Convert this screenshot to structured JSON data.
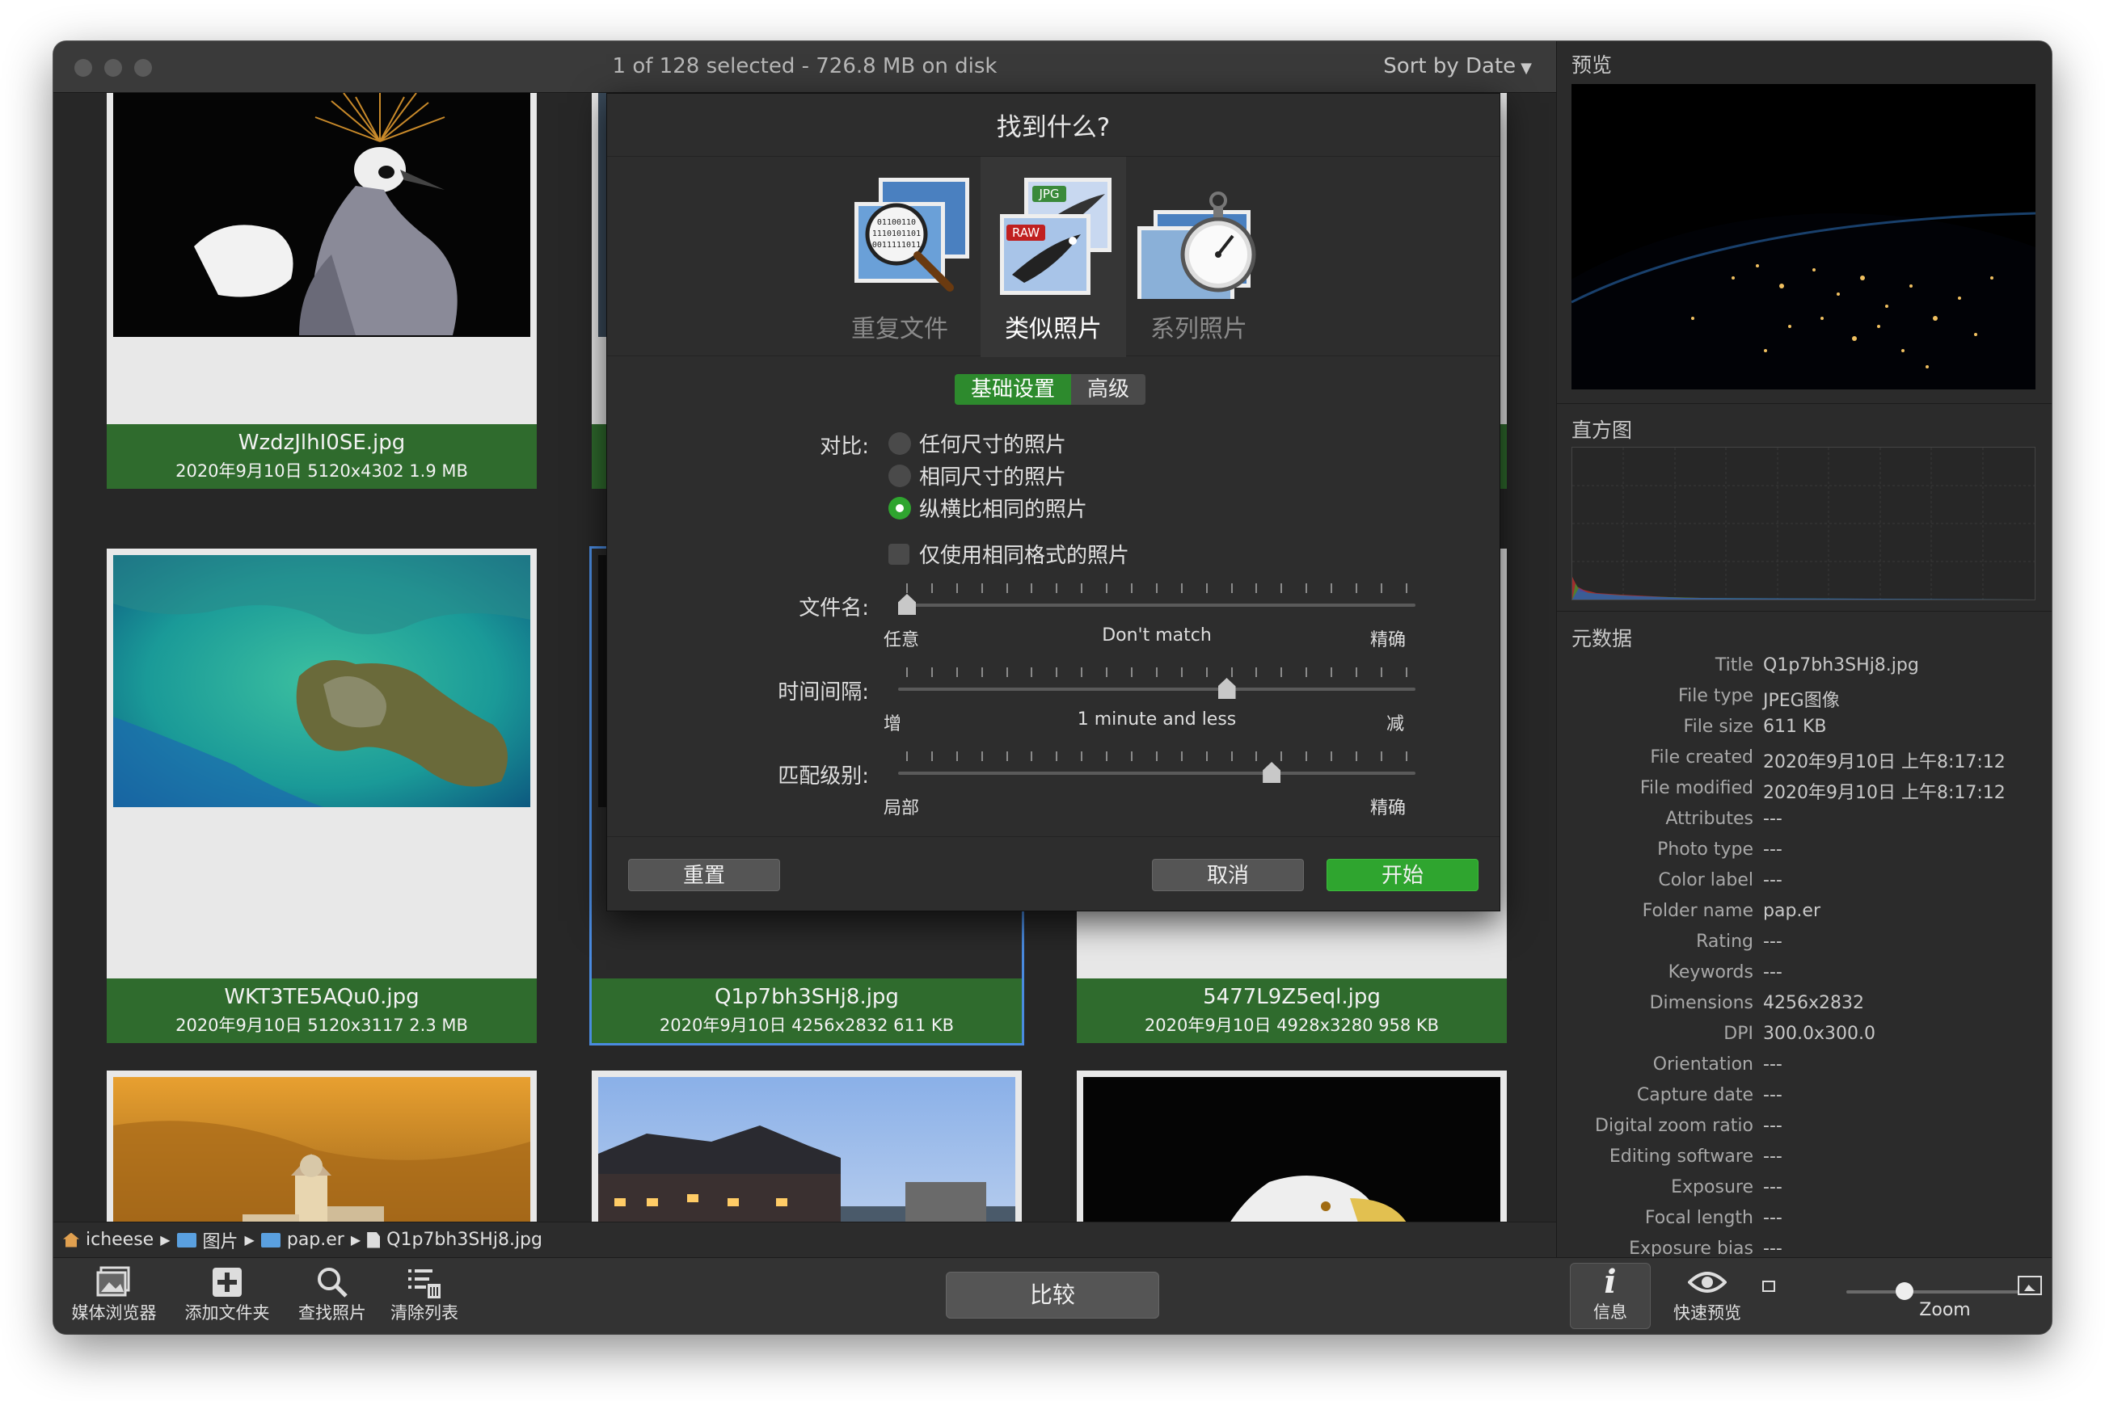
{
  "titlebar": {
    "title": "1 of 128 selected - 726.8 MB on disk",
    "sort_label": "Sort by Date",
    "sort_arrow": "▼"
  },
  "thumbnails": [
    {
      "filename": "WzdzJlhI0SE.jpg",
      "meta": "2020年9月10日  5120x4302  1.9 MB",
      "icon": "crowned-crane-photo"
    },
    {
      "filename": "WKT3TE5AQu0.jpg",
      "meta": "2020年9月10日  5120x3117  2.3 MB",
      "icon": "satellite-coast-photo"
    },
    {
      "filename": "Q1p7bh3SHj8.jpg",
      "meta": "2020年9月10日  4256x2832  611 KB",
      "icon": "earth-night-photo"
    },
    {
      "filename": "5477L9Z5eql.jpg",
      "meta": "2020年9月10日  4928x3280  958 KB",
      "icon": "unknown-photo"
    }
  ],
  "pathbar": {
    "items": [
      "icheese",
      "图片",
      "pap.er",
      "Q1p7bh3SHj8.jpg"
    ],
    "separator": "▶"
  },
  "toolbar": {
    "media_browser": "媒体浏览器",
    "add_folder": "添加文件夹",
    "find_photos": "查找照片",
    "clear_list": "清除列表",
    "compare": "比较",
    "info": "信息",
    "quick_preview": "快速预览",
    "zoom": "Zoom"
  },
  "sidebar": {
    "preview_title": "预览",
    "histogram_title": "直方图",
    "metadata_title": "元数据",
    "metadata": [
      {
        "k": "Title",
        "v": "Q1p7bh3SHj8.jpg"
      },
      {
        "k": "File type",
        "v": "JPEG图像"
      },
      {
        "k": "File size",
        "v": "611 KB"
      },
      {
        "k": "File created",
        "v": "2020年9月10日 上午8:17:12"
      },
      {
        "k": "File modified",
        "v": "2020年9月10日 上午8:17:12"
      },
      {
        "k": "Attributes",
        "v": "---"
      },
      {
        "k": "Photo type",
        "v": "---"
      },
      {
        "k": "Color label",
        "v": "---"
      },
      {
        "k": "Folder name",
        "v": "pap.er"
      },
      {
        "k": "Rating",
        "v": "---"
      },
      {
        "k": "Keywords",
        "v": "---"
      },
      {
        "k": "Dimensions",
        "v": "4256x2832"
      },
      {
        "k": "DPI",
        "v": "300.0x300.0"
      },
      {
        "k": "Orientation",
        "v": "---"
      },
      {
        "k": "Capture date",
        "v": "---"
      },
      {
        "k": "Digital zoom ratio",
        "v": "---"
      },
      {
        "k": "Editing software",
        "v": "---"
      },
      {
        "k": "Exposure",
        "v": "---"
      },
      {
        "k": "Focal length",
        "v": "---"
      },
      {
        "k": "Exposure bias",
        "v": "---"
      }
    ]
  },
  "dialog": {
    "title": "找到什么?",
    "modes": [
      "重复文件",
      "类似照片",
      "系列照片"
    ],
    "active_mode": "类似照片",
    "mode_badges": {
      "jpg": "JPG",
      "raw": "RAW",
      "binary": "01100110"
    },
    "tabs": {
      "basic": "基础设置",
      "advanced": "高级"
    },
    "compare_label": "对比:",
    "compare_options": [
      "任何尺寸的照片",
      "相同尺寸的照片",
      "纵横比相同的照片"
    ],
    "compare_selected": 2,
    "same_format_label": "仅使用相同格式的照片",
    "same_format_checked": false,
    "filename": {
      "label": "文件名:",
      "left": "任意",
      "center": "Don't match",
      "right": "精确",
      "value_fraction": 0.0
    },
    "time_interval": {
      "label": "时间间隔:",
      "left": "增",
      "center": "1 minute and less",
      "right": "减",
      "value_fraction": 0.64
    },
    "match_level": {
      "label": "匹配级别:",
      "left": "局部",
      "right": "精确",
      "value_fraction": 0.73
    },
    "buttons": {
      "reset": "重置",
      "cancel": "取消",
      "start": "开始"
    }
  },
  "colors": {
    "accent_green": "#2fa52f",
    "caption_green": "#2f6b2d",
    "selection_blue": "#4a8be0"
  },
  "zoom_fraction": 0.3
}
